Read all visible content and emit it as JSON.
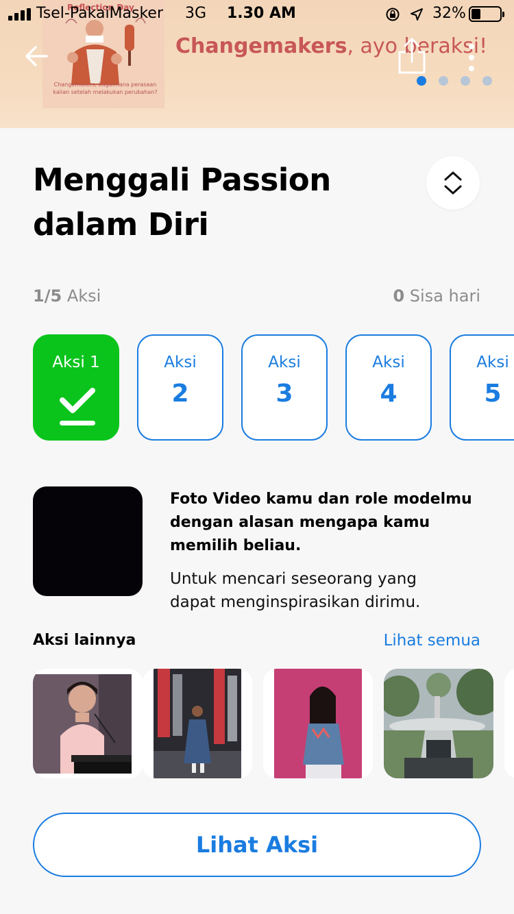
{
  "status_bar": {
    "carrier": "Tsel-PakaiMasker",
    "network": "3G",
    "time": "1.30 AM",
    "battery": "32%",
    "battery_level": 0.32
  },
  "banner": {
    "card_title": "Reflection Day",
    "card_caption": "Changemakers, bagaimana perasaan kalian setelah melakukan perubahan?",
    "headline_bold": "Changemakers",
    "headline_rest": ", ayo beraksi!",
    "slide_count": 4,
    "active_slide": 1
  },
  "challenge": {
    "title": "Menggali Passion dalam Diri",
    "progress_current": "1/5",
    "progress_label": "Aksi",
    "days_left": "0",
    "days_label": "Sisa hari"
  },
  "steps": [
    {
      "label": "Aksi 1",
      "number": "",
      "done": true
    },
    {
      "label": "Aksi",
      "number": "2",
      "done": false
    },
    {
      "label": "Aksi",
      "number": "3",
      "done": false
    },
    {
      "label": "Aksi",
      "number": "4",
      "done": false
    },
    {
      "label": "Aksi",
      "number": "5",
      "done": false
    }
  ],
  "task": {
    "title": "Foto  Video kamu dan role modelmu dengan alasan mengapa kamu memilih beliau.",
    "description": "Untuk mencari seseorang yang dapat menginspirasikan dirimu."
  },
  "others": {
    "heading": "Aksi lainnya",
    "see_all": "Lihat semua"
  },
  "cta_label": "Lihat Aksi",
  "colors": {
    "accent": "#1a7ce0",
    "done": "#0ac41c",
    "banner_text": "#c85757"
  }
}
